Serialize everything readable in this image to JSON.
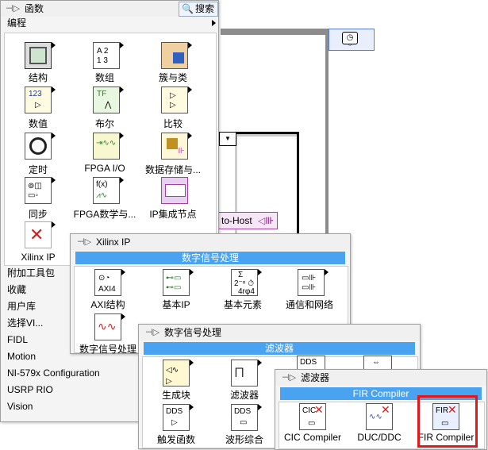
{
  "main_palette": {
    "title": "函数",
    "search_label": "搜索",
    "category": "编程",
    "tiles": [
      {
        "label": "结构"
      },
      {
        "label": "数组"
      },
      {
        "label": "簇与类"
      },
      {
        "label": "数值"
      },
      {
        "label": "布尔"
      },
      {
        "label": "比较"
      },
      {
        "label": "定时"
      },
      {
        "label": "FPGA I/O"
      },
      {
        "label": "数据存储与..."
      },
      {
        "label": "同步"
      },
      {
        "label": "FPGA数学与..."
      },
      {
        "label": "IP集成节点"
      },
      {
        "label": "Xilinx IP"
      }
    ],
    "list_items": [
      "附加工具包",
      "收藏",
      "用户库",
      "选择VI...",
      "FIDL",
      "Motion",
      "NI-579x Configuration",
      "USRP RIO",
      "Vision"
    ]
  },
  "xilinx_palette": {
    "title": "Xilinx IP",
    "subheader": "数字信号处理",
    "tiles": [
      {
        "label": "AXI结构"
      },
      {
        "label": "基本IP"
      },
      {
        "label": "基本元素"
      },
      {
        "label": "通信和网络"
      },
      {
        "label": "数字信号处理"
      }
    ]
  },
  "dsp_palette": {
    "title": "数字信号处理",
    "subheader": "滤波器",
    "tiles": [
      {
        "label": "生成块"
      },
      {
        "label": "滤波器"
      },
      {
        "label": "触发函数"
      },
      {
        "label": "波形综合"
      }
    ]
  },
  "filter_palette": {
    "title": "滤波器",
    "subheader": "FIR Compiler",
    "tiles": [
      {
        "label": "CIC Compiler"
      },
      {
        "label": "DUC/DDC"
      },
      {
        "label": "FIR Compiler"
      }
    ]
  },
  "block_diagram": {
    "fifo_label": "to-Host",
    "colors": {
      "highlight": "#e01818",
      "subheader": "#4aa3f0",
      "frame": "#8c8c8c"
    }
  }
}
